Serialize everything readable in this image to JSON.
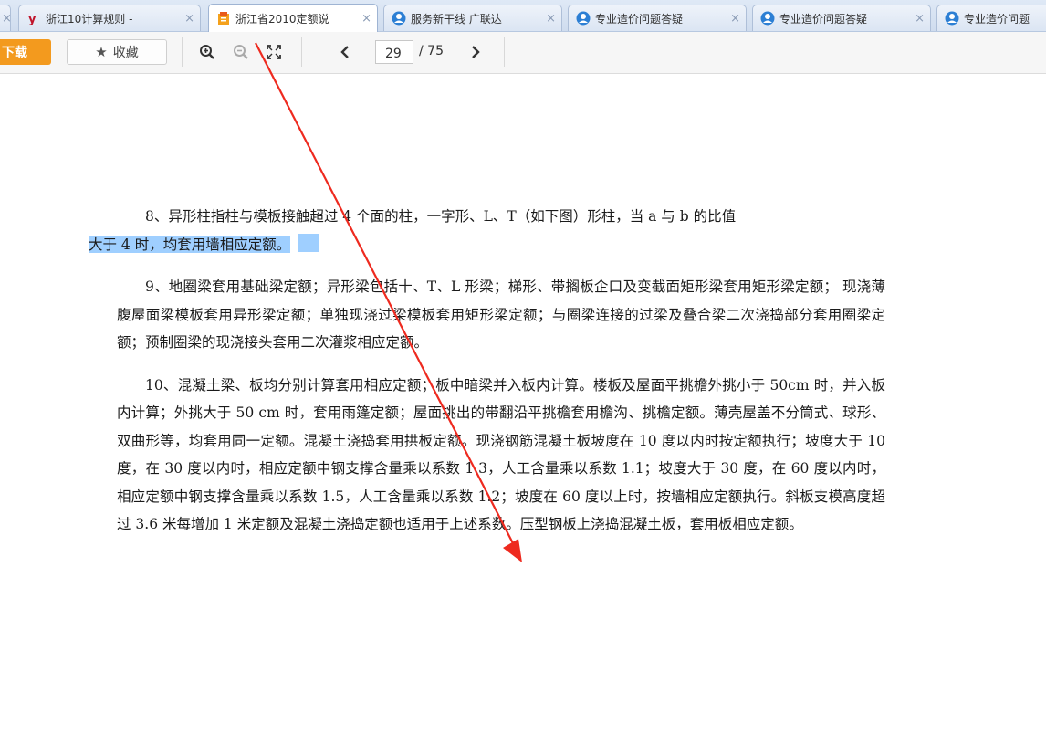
{
  "tabs": [
    {
      "icon": "document-icon",
      "title": "浙江10计算规则 - ",
      "active": false
    },
    {
      "icon": "document-icon",
      "title": "浙江省2010定额说",
      "active": true
    },
    {
      "icon": "user-icon",
      "title": "服务新干线 广联达",
      "active": false
    },
    {
      "icon": "user-icon",
      "title": "专业造价问题答疑",
      "active": false
    },
    {
      "icon": "user-icon",
      "title": "专业造价问题答疑",
      "active": false
    },
    {
      "icon": "user-icon",
      "title": "专业造价问题",
      "active": false
    }
  ],
  "toolbar": {
    "download_label": "下载",
    "collect_label": "收藏",
    "current_page": "29",
    "total_pages": "/ 75"
  },
  "document": {
    "p8_text": "8、异形柱指柱与模板接触超过 4 个面的柱，一字形、L、T（如下图）形柱，当 a 与 b 的比值",
    "p8_highlight": "大于 4 时，均套用墙相应定额。",
    "p9": "9、地圈梁套用基础梁定额；异形梁包括十、T、L 形梁；梯形、带搁板企口及变截面矩形梁套用矩形梁定额； 现浇薄腹屋面梁模板套用异形梁定额；单独现浇过梁模板套用矩形梁定额；与圈梁连接的过梁及叠合梁二次浇捣部分套用圈梁定额；预制圈梁的现浇接头套用二次灌浆相应定额。",
    "p10": "10、混凝土梁、板均分别计算套用相应定额；板中暗梁并入板内计算。楼板及屋面平挑檐外挑小于 50cm 时，并入板内计算；外挑大于 50 cm 时，套用雨篷定额；屋面挑出的带翻沿平挑檐套用檐沟、挑檐定额。薄壳屋盖不分筒式、球形、双曲形等，均套用同一定额。混凝土浇捣套用拱板定额。现浇钢筋混凝土板坡度在 10 度以内时按定额执行；坡度大于 10 度，在 30 度以内时，相应定额中钢支撑含量乘以系数 1.3，人工含量乘以系数 1.1；坡度大于 30 度，在 60 度以内时，相应定额中钢支撑含量乘以系数 1.5，人工含量乘以系数 1.2；坡度在 60 度以上时，按墙相应定额执行。斜板支模高度超过 3.6 米每增加 1 米定额及混凝土浇捣定额也适用于上述系数。压型钢板上浇捣混凝土板，套用板相应定额。"
  },
  "colors": {
    "highlight": "#9fcfff",
    "download_button": "#f39a1e",
    "annotation_arrow": "#ee2a1f"
  }
}
